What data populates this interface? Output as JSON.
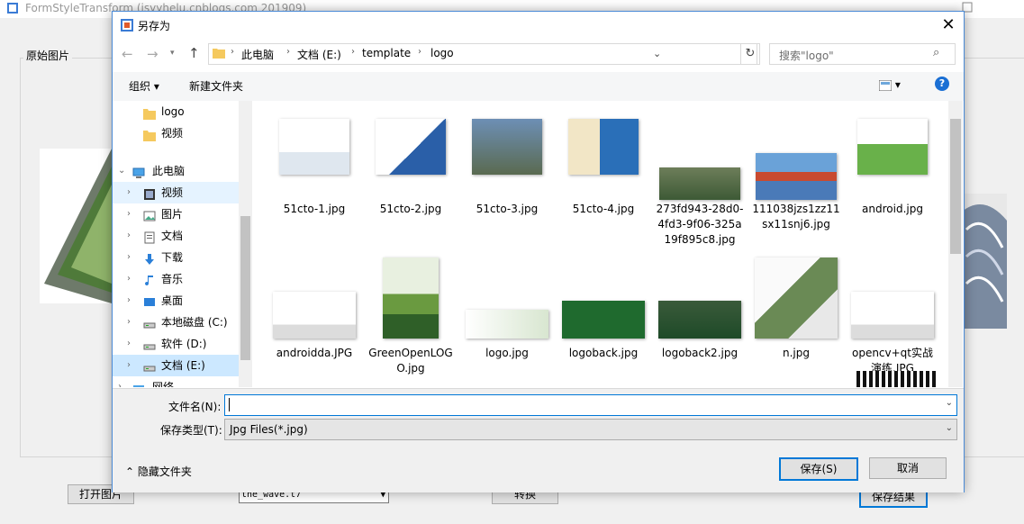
{
  "background_app": {
    "title": "FormStyleTransform (jsyyhelu.cnblogs.com 201909)",
    "group_label": "原始图片",
    "open_button": "打开图片",
    "style_combo": "the_wave.t7",
    "convert_button": "转换",
    "save_button": "保存结果"
  },
  "dialog": {
    "title": "另存为",
    "close": "✕",
    "breadcrumb": [
      "此电脑",
      "文档 (E:)",
      "template",
      "logo"
    ],
    "search_placeholder": "搜索\"logo\"",
    "toolbar": {
      "organize": "组织 ▾",
      "new_folder": "新建文件夹",
      "help": "?"
    },
    "nav_items": [
      {
        "label": "logo",
        "icon": "folder-icon"
      },
      {
        "label": "视频",
        "icon": "folder-icon"
      },
      {
        "label": "此电脑",
        "icon": "pc-icon"
      },
      {
        "label": "视频",
        "icon": "video-icon"
      },
      {
        "label": "图片",
        "icon": "picture-icon"
      },
      {
        "label": "文档",
        "icon": "document-icon"
      },
      {
        "label": "下载",
        "icon": "download-icon"
      },
      {
        "label": "音乐",
        "icon": "music-icon"
      },
      {
        "label": "桌面",
        "icon": "desktop-icon"
      },
      {
        "label": "本地磁盘 (C:)",
        "icon": "drive-icon"
      },
      {
        "label": "软件 (D:)",
        "icon": "drive-icon"
      },
      {
        "label": "文档 (E:)",
        "icon": "drive-icon"
      },
      {
        "label": "网络",
        "icon": "network-icon"
      }
    ],
    "files": [
      {
        "name": "51cto-1.jpg"
      },
      {
        "name": "51cto-2.jpg"
      },
      {
        "name": "51cto-3.jpg"
      },
      {
        "name": "51cto-4.jpg"
      },
      {
        "name": "273fd943-28d0-4fd3-9f06-325a19f895c8.jpg"
      },
      {
        "name": "111038jzs1zz11sx11snj6.jpg"
      },
      {
        "name": "android.jpg"
      },
      {
        "name": "androidda.JPG"
      },
      {
        "name": "GreenOpenLOGO.jpg"
      },
      {
        "name": "logo.jpg"
      },
      {
        "name": "logoback.jpg"
      },
      {
        "name": "logoback2.jpg"
      },
      {
        "name": "n.jpg"
      },
      {
        "name": "opencv+qt实战演练.JPG"
      }
    ],
    "filename_label": "文件名(N):",
    "filename_value": "",
    "filetype_label": "保存类型(T):",
    "filetype_value": "Jpg Files(*.jpg)",
    "hide_folders": "隐藏文件夹",
    "save_button": "保存(S)",
    "cancel_button": "取消",
    "accent_color": "#0078d7"
  }
}
